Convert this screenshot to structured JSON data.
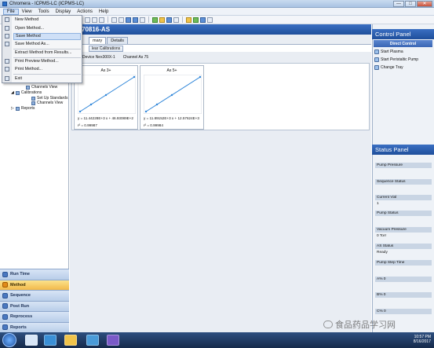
{
  "window": {
    "title": "Chromera - ICPMS-LC (ICPMS-LC)",
    "min": "—",
    "max": "□",
    "close": "✕"
  },
  "menubar": [
    "File",
    "View",
    "Tools",
    "Display",
    "Actions",
    "Help"
  ],
  "file_menu": [
    "New Method",
    "Open Method...",
    "Save Method",
    "Save Method As...",
    "Extract Method from Results...",
    "Print Preview Method...",
    "Print Method...",
    "Exit"
  ],
  "file_menu_selected": "Save Method",
  "method_title": "70816-AS",
  "tabs": [
    "mary",
    "Details"
  ],
  "clear_button": "lear Calibrations",
  "device_label": "Device  Nex300X-1",
  "channel_label": "Channel  As 75",
  "tree": [
    "Channels View",
    "Calibrations",
    "Set Up Standards",
    "Channels View",
    "Reports"
  ],
  "nav": [
    "Run Time",
    "Method",
    "Sequence",
    "Post Run",
    "Reprocess",
    "Reports"
  ],
  "nav_selected": "Method",
  "cards": [
    {
      "title": "As 3+",
      "equation": "y = 11.44228E+3 x + 46.93089E+2",
      "r2": "r² =   0.99987"
    },
    {
      "title": "As 5+",
      "equation": "y = 11.89152E+3 x + 12.57624E+3",
      "r2": "r² =   0.99984"
    }
  ],
  "control_panel": {
    "title": "Control Panel",
    "section": "Direct Control",
    "items": [
      "Start Plasma",
      "Start Peristaltic Pump",
      "Change Tray"
    ]
  },
  "status_panel": {
    "title": "Status Panel",
    "labels": [
      "Pump Pressure",
      "Sequence Status",
      "Current Vial",
      "Pump Status",
      "Vacuum Pressure",
      "AS Status",
      "Pump Step Time",
      "A% 0",
      "B% 0",
      "C% 0"
    ],
    "values": {
      "current_vial": "1",
      "vacuum": "0 Torr",
      "as_status": "Ready"
    }
  },
  "taskbar": {
    "time": "10:57 PM",
    "date": "8/16/2017"
  },
  "watermark": "食品药品学习网"
}
